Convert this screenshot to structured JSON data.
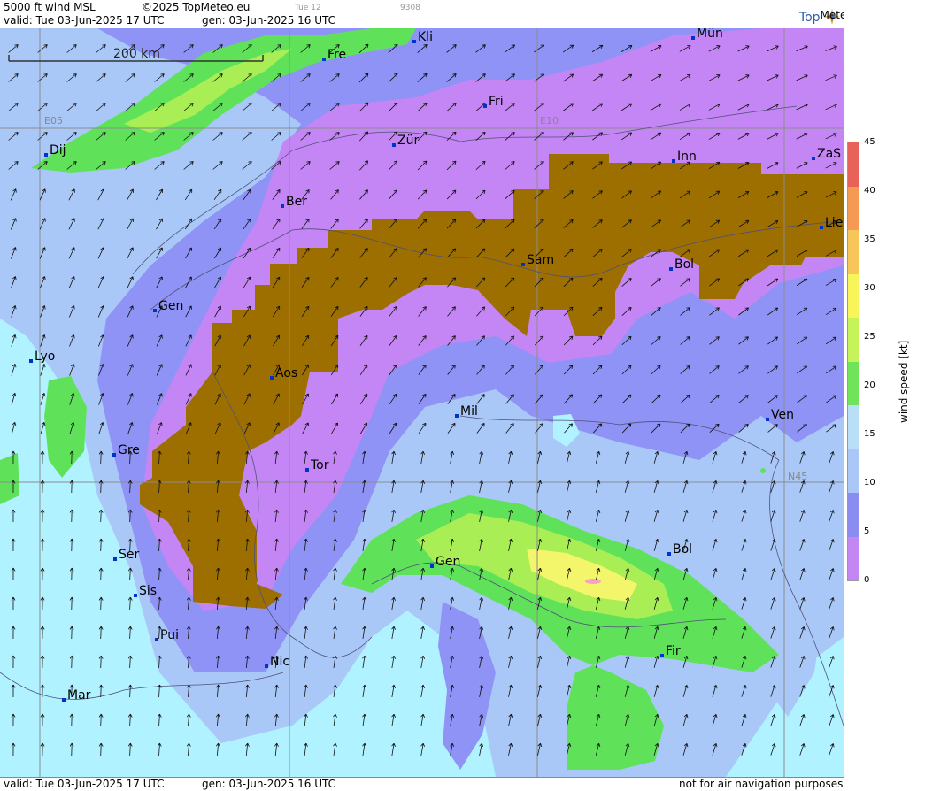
{
  "header": {
    "product": "5000 ft wind MSL",
    "copyright": "©2025 TopMeteo.eu",
    "valid": "valid:  Tue  03-Jun-2025  17 UTC",
    "gen": "gen: 03-Jun-2025 16 UTC",
    "faint_a": "Tue 12",
    "faint_b": "9308",
    "logo_a": "Top",
    "logo_b": "Meteo"
  },
  "footer": {
    "valid": "valid:  Tue  03-Jun-2025  17 UTC",
    "gen": "gen: 03-Jun-2025 16 UTC",
    "disclaimer": "not for air navigation purposes"
  },
  "map": {
    "scale_label": "200 km",
    "grid_labels": {
      "e05": "E05",
      "e10": "E10",
      "n45": "N45"
    },
    "cities": [
      {
        "label": "Kli"
      },
      {
        "label": "Mün"
      },
      {
        "label": "Fre"
      },
      {
        "label": "Fri"
      },
      {
        "label": "Zür"
      },
      {
        "label": "Dij"
      },
      {
        "label": "Inn"
      },
      {
        "label": "ZaS"
      },
      {
        "label": "Ber"
      },
      {
        "label": "Lie"
      },
      {
        "label": "Sam"
      },
      {
        "label": "Bol"
      },
      {
        "label": "Gen"
      },
      {
        "label": "Lyo"
      },
      {
        "label": "Aos"
      },
      {
        "label": "Mil"
      },
      {
        "label": "Ven"
      },
      {
        "label": "Gre"
      },
      {
        "label": "Tor"
      },
      {
        "label": "Ser"
      },
      {
        "label": "Gen"
      },
      {
        "label": "Bol"
      },
      {
        "label": "Sis"
      },
      {
        "label": "Pui"
      },
      {
        "label": "Nic"
      },
      {
        "label": "Fir"
      },
      {
        "label": "Mar"
      }
    ],
    "colors": {
      "terrain": "#9c6f00",
      "lightblue": "#b0f2ff",
      "blue": "#a9c8f8",
      "medblue": "#8e93f5",
      "purple": "#c486f4",
      "green": "#5fe25a",
      "lime": "#a9ee55",
      "yellow": "#f3f56a",
      "pink": "#f5a2c6"
    }
  },
  "legend": {
    "title": "wind speed [kt]",
    "ticks": [
      "45",
      "40",
      "35",
      "30",
      "25",
      "20",
      "15",
      "10",
      "5",
      "0"
    ],
    "colors": [
      "#e8625a",
      "#f49a55",
      "#f7c65a",
      "#f7f55a",
      "#c6f25a",
      "#6fe35a",
      "#b8def8",
      "#a9c8f8",
      "#8a8cf0",
      "#c287f2"
    ]
  }
}
